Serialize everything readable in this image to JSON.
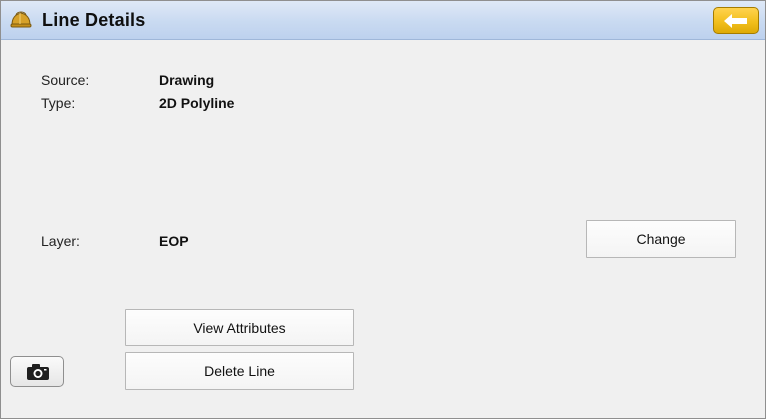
{
  "header": {
    "title": "Line Details",
    "icon": "hard-hat-icon",
    "back_icon": "left-arrow-icon"
  },
  "details": {
    "source_label": "Source:",
    "source_value": "Drawing",
    "type_label": "Type:",
    "type_value": "2D Polyline",
    "layer_label": "Layer:",
    "layer_value": "EOP"
  },
  "actions": {
    "change_label": "Change",
    "view_attributes_label": "View Attributes",
    "delete_line_label": "Delete Line",
    "camera_icon": "camera-icon"
  },
  "colors": {
    "titlebar": "#c9daf1",
    "back_button": "#f2bf1d",
    "background": "#f0f0f0"
  }
}
